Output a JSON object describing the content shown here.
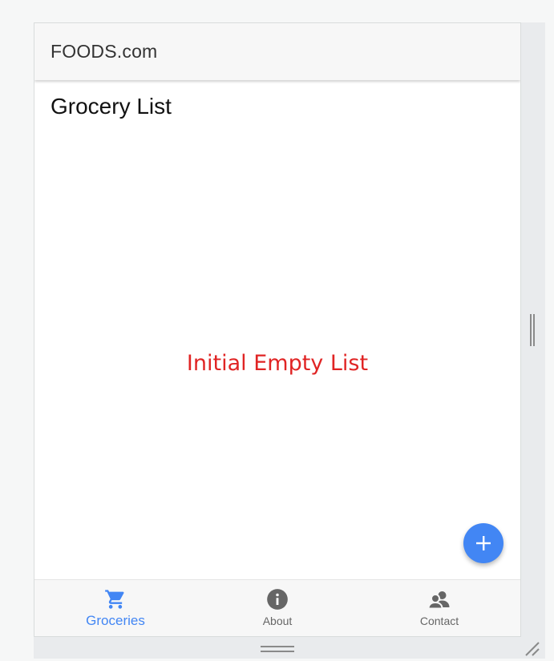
{
  "app": {
    "title": "FOODS.com"
  },
  "page": {
    "title": "Grocery List",
    "empty_message": "Initial Empty List"
  },
  "fab": {
    "icon": "plus-icon"
  },
  "nav": {
    "items": [
      {
        "label": "Groceries",
        "icon": "cart-icon",
        "active": true
      },
      {
        "label": "About",
        "icon": "info-icon",
        "active": false
      },
      {
        "label": "Contact",
        "icon": "people-icon",
        "active": false
      }
    ]
  },
  "colors": {
    "accent": "#4286f4",
    "empty_message": "#e02424",
    "inactive_icon": "#666666"
  }
}
